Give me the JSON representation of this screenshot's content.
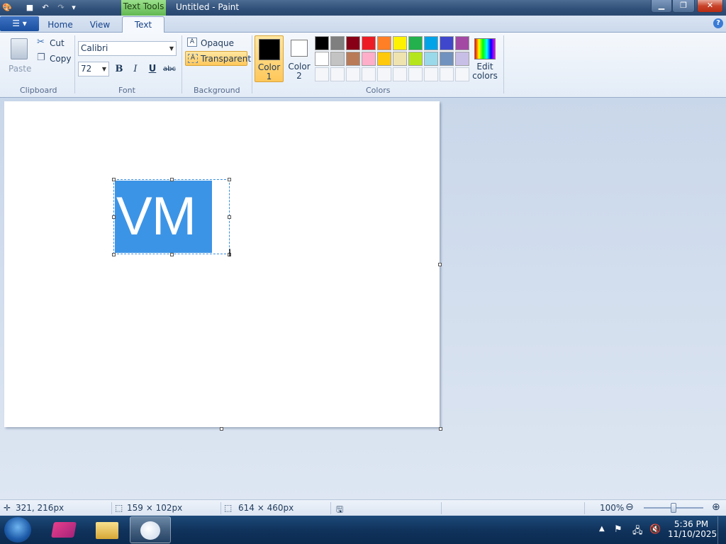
{
  "window": {
    "context_tab": "Text Tools",
    "title": "Untitled - Paint",
    "min_icon": "minimize-icon",
    "max_icon": "maximize-icon",
    "close_icon": "close-icon",
    "min_glyph": "▁",
    "max_glyph": "❐",
    "close_glyph": "✕"
  },
  "quick_access": {
    "paint_glyph": "🎨",
    "save_glyph": "■",
    "undo_glyph": "↶",
    "redo_glyph": "↷",
    "dropdown_glyph": "▾"
  },
  "tabs": {
    "file": "☰ ▾",
    "home": "Home",
    "view": "View",
    "text": "Text",
    "help": "?"
  },
  "ribbon": {
    "clipboard": {
      "label": "Clipboard",
      "paste": "Paste",
      "cut": "Cut",
      "copy": "Copy",
      "cut_glyph": "✂",
      "copy_glyph": "❐"
    },
    "font": {
      "label": "Font",
      "family": "Calibri",
      "size": "72",
      "bold": "B",
      "italic": "I",
      "underline": "U",
      "strike": "abc"
    },
    "background": {
      "label": "Background",
      "opaque": "Opaque",
      "transparent": "Transparent",
      "selected": "Transparent"
    },
    "colors": {
      "label": "Colors",
      "color1_label": "Color\n1",
      "color2_label": "Color\n2",
      "color1": "#000000",
      "color2": "#ffffff",
      "edit": "Edit\ncolors",
      "palette_row1": [
        "#000000",
        "#7f7f7f",
        "#880015",
        "#ed1c24",
        "#ff7f27",
        "#fff200",
        "#22b14c",
        "#00a2e8",
        "#3f48cc",
        "#a349a4"
      ],
      "palette_row2": [
        "#ffffff",
        "#c3c3c3",
        "#b97a57",
        "#ffaec9",
        "#ffc90e",
        "#efe4b0",
        "#b5e61d",
        "#99d9ea",
        "#7092be",
        "#c8bfe7"
      ]
    }
  },
  "canvas": {
    "text": "VM",
    "text_bg": "#3c94e6"
  },
  "status": {
    "cursor_pos": "321, 216px",
    "selection_size": "159 × 102px",
    "canvas_size": "614 × 460px",
    "zoom": "100%",
    "zoom_level_percent": 100
  },
  "taskbar": {
    "time": "5:36 PM",
    "date": "11/10/2025"
  }
}
